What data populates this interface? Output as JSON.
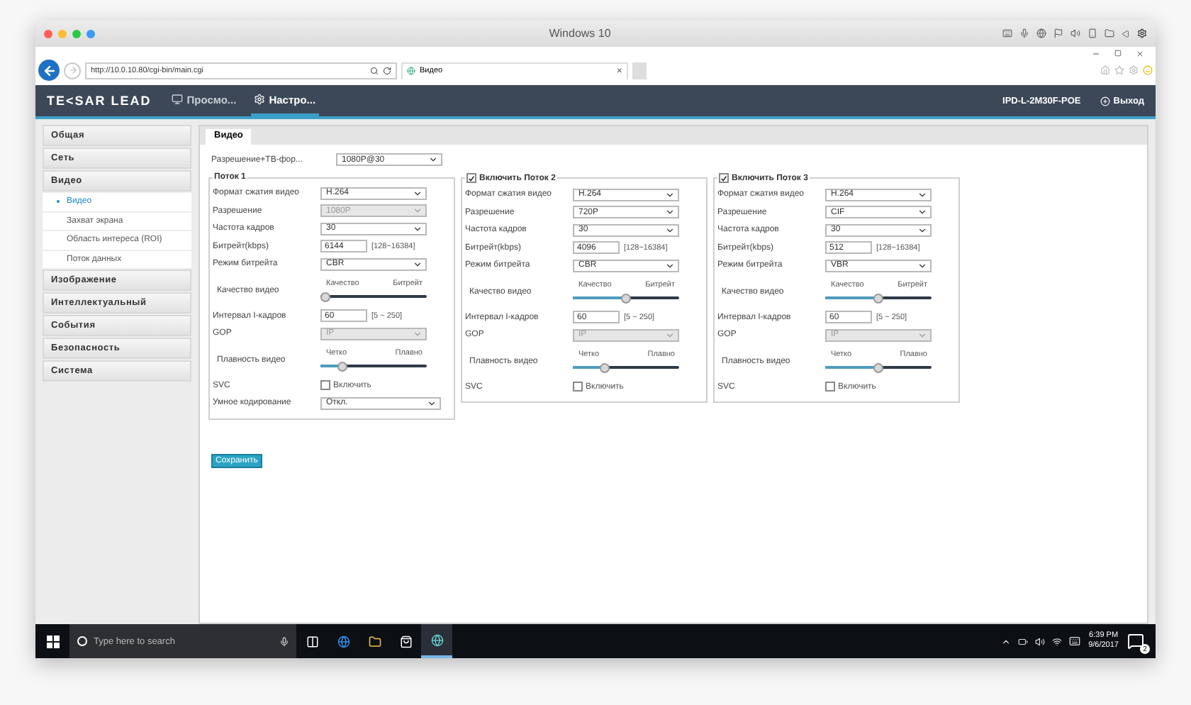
{
  "window": {
    "title": "Windows 10"
  },
  "browser": {
    "address": "http://10.0.10.80/cgi-bin/main.cgi",
    "tab": {
      "label": "Видео",
      "close": "×"
    }
  },
  "app": {
    "logo": "TE<SAR LEAD",
    "device": "IPD-L-2M30F-POE",
    "logout": "Выход",
    "nav": [
      {
        "label": "Просмо...",
        "selected": false
      },
      {
        "label": "Настро...",
        "selected": true
      }
    ]
  },
  "sidebar": [
    {
      "label": "Общая"
    },
    {
      "label": "Сеть"
    },
    {
      "label": "Видео",
      "children": [
        {
          "label": "Видео",
          "selected": true
        },
        {
          "label": "Захват экрана",
          "selected": false
        },
        {
          "label": "Область интереса (ROI)",
          "selected": false
        },
        {
          "label": "Поток данных",
          "selected": false
        }
      ]
    },
    {
      "label": "Изображение"
    },
    {
      "label": "Интеллектуальный"
    },
    {
      "label": "События"
    },
    {
      "label": "Безопасность"
    },
    {
      "label": "Система"
    }
  ],
  "page_tab": {
    "label": "Видео",
    "selected": true
  },
  "resolution": {
    "label": "Разрешение+ТВ-фор...",
    "value": "1080P@30"
  },
  "streams": [
    {
      "title": "Поток 1",
      "kind": "plain",
      "rows": [
        {
          "kind": "select",
          "label": "Формат сжатия видео",
          "value": "H.264",
          "disabled": false
        },
        {
          "kind": "select",
          "label": "Разрешение",
          "value": "1080P",
          "disabled": true
        },
        {
          "kind": "select",
          "label": "Частота кадров",
          "value": "30",
          "disabled": false
        },
        {
          "kind": "input",
          "label": "Битрейт(kbps)",
          "value": "6144",
          "range": "[128~16384]"
        },
        {
          "kind": "select",
          "label": "Режим битрейта",
          "value": "CBR",
          "disabled": false
        },
        {
          "kind": "slider",
          "label": "Качество видео",
          "left": "Качество",
          "right": "Битрейт",
          "level": 0
        },
        {
          "kind": "input",
          "label": "Интервал I-кадров",
          "value": "60",
          "range": "[5 ~ 250]"
        },
        {
          "kind": "select",
          "label": "GOP",
          "value": "IP",
          "disabled": true
        },
        {
          "kind": "slider",
          "label": "Плавность видео",
          "left": "Четко",
          "right": "Плавно",
          "level": 0.2
        },
        {
          "kind": "checkbox",
          "label": "SVC",
          "text": "Включить",
          "checked": false
        },
        {
          "kind": "select",
          "label": "Умное кодирование",
          "value": "Откл.",
          "disabled": false
        }
      ]
    },
    {
      "title": "Включить Поток 2",
      "kind": "toggle",
      "checked": true,
      "rows": [
        {
          "kind": "select",
          "label": "Формат сжатия видео",
          "value": "H.264",
          "disabled": false
        },
        {
          "kind": "select",
          "label": "Разрешение",
          "value": "720P",
          "disabled": false
        },
        {
          "kind": "select",
          "label": "Частота кадров",
          "value": "30",
          "disabled": false
        },
        {
          "kind": "input",
          "label": "Битрейт(kbps)",
          "value": "4096",
          "range": "[128~16384]"
        },
        {
          "kind": "select",
          "label": "Режим битрейта",
          "value": "CBR",
          "disabled": false
        },
        {
          "kind": "slider",
          "label": "Качество видео",
          "left": "Качество",
          "right": "Битрейт",
          "level": 0.5
        },
        {
          "kind": "input",
          "label": "Интервал I-кадров",
          "value": "60",
          "range": "[5 ~ 250]"
        },
        {
          "kind": "select",
          "label": "GOP",
          "value": "IP",
          "disabled": true
        },
        {
          "kind": "slider",
          "label": "Плавность видео",
          "left": "Четко",
          "right": "Плавно",
          "level": 0.3
        },
        {
          "kind": "checkbox",
          "label": "SVC",
          "text": "Включить",
          "checked": false
        }
      ]
    },
    {
      "title": "Включить Поток 3",
      "kind": "toggle",
      "checked": true,
      "rows": [
        {
          "kind": "select",
          "label": "Формат сжатия видео",
          "value": "H.264",
          "disabled": false
        },
        {
          "kind": "select",
          "label": "Разрешение",
          "value": "CIF",
          "disabled": false
        },
        {
          "kind": "select",
          "label": "Частота кадров",
          "value": "30",
          "disabled": false
        },
        {
          "kind": "input",
          "label": "Битрейт(kbps)",
          "value": "512",
          "range": "[128~16384]"
        },
        {
          "kind": "select",
          "label": "Режим битрейта",
          "value": "VBR",
          "disabled": false
        },
        {
          "kind": "slider",
          "label": "Качество видео",
          "left": "Качество",
          "right": "Битрейт",
          "level": 0.5
        },
        {
          "kind": "input",
          "label": "Интервал I-кадров",
          "value": "60",
          "range": "[5 ~ 250]"
        },
        {
          "kind": "select",
          "label": "GOP",
          "value": "IP",
          "disabled": true
        },
        {
          "kind": "slider",
          "label": "Плавность видео",
          "left": "Четко",
          "right": "Плавно",
          "level": 0.5
        },
        {
          "kind": "checkbox",
          "label": "SVC",
          "text": "Включить",
          "checked": false
        }
      ]
    }
  ],
  "save": "Сохранить",
  "taskbar": {
    "search": "Type here to search",
    "time": "6:39 PM",
    "date": "9/6/2017",
    "notifications": "2"
  }
}
